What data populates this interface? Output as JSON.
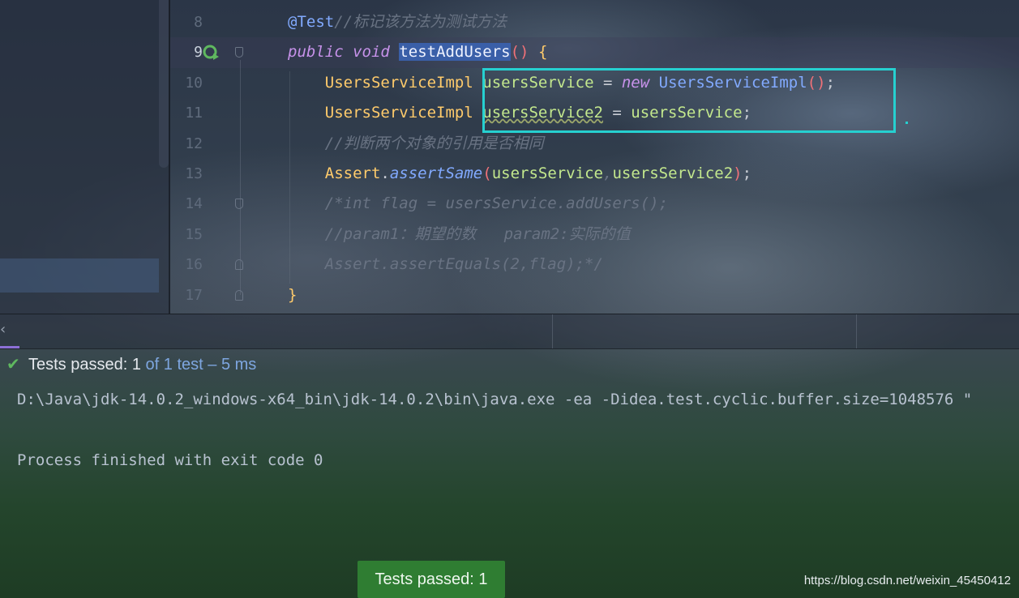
{
  "editor": {
    "current_line": "9",
    "lines": [
      {
        "num": "8",
        "tokens": [
          {
            "t": "@Test",
            "c": "ann"
          },
          {
            "t": "//标记该方法为测试方法",
            "c": "cmt"
          }
        ]
      },
      {
        "num": "9",
        "tokens": [
          {
            "t": "public",
            "c": "kw"
          },
          {
            "t": " "
          },
          {
            "t": "void",
            "c": "kw"
          },
          {
            "t": " "
          },
          {
            "t": "testAddUsers",
            "c": "hl"
          },
          {
            "t": "()",
            "c": "paren"
          },
          {
            "t": " "
          },
          {
            "t": "{",
            "c": "brace"
          }
        ]
      },
      {
        "num": "10",
        "tokens": [
          {
            "t": "    "
          },
          {
            "t": "UsersServiceImpl",
            "c": "ty"
          },
          {
            "t": " "
          },
          {
            "t": "usersService",
            "c": "var"
          },
          {
            "t": " = "
          },
          {
            "t": "new",
            "c": "kw"
          },
          {
            "t": " "
          },
          {
            "t": "UsersServiceImpl",
            "c": "fn"
          },
          {
            "t": "()",
            "c": "paren"
          },
          {
            "t": ";"
          }
        ]
      },
      {
        "num": "11",
        "tokens": [
          {
            "t": "    "
          },
          {
            "t": "UsersServiceImpl",
            "c": "ty"
          },
          {
            "t": " "
          },
          {
            "t": "usersService2",
            "c": "var squig"
          },
          {
            "t": " = "
          },
          {
            "t": "usersService",
            "c": "var"
          },
          {
            "t": ";"
          }
        ]
      },
      {
        "num": "12",
        "tokens": [
          {
            "t": "    "
          },
          {
            "t": "//判断两个对象的引用是否相同",
            "c": "cmt"
          }
        ]
      },
      {
        "num": "13",
        "tokens": [
          {
            "t": "    "
          },
          {
            "t": "Assert",
            "c": "ty"
          },
          {
            "t": "."
          },
          {
            "t": "assertSame",
            "c": "fni"
          },
          {
            "t": "(",
            "c": "paren"
          },
          {
            "t": "usersService",
            "c": "var"
          },
          {
            "t": ",",
            "c": "cmt"
          },
          {
            "t": "usersService2",
            "c": "var"
          },
          {
            "t": ")",
            "c": "paren"
          },
          {
            "t": ";"
          }
        ]
      },
      {
        "num": "14",
        "tokens": [
          {
            "t": "    "
          },
          {
            "t": "/*int flag = usersService.addUsers();",
            "c": "cmt"
          }
        ]
      },
      {
        "num": "15",
        "tokens": [
          {
            "t": "    "
          },
          {
            "t": "//param1：期望的数   param2:实际的值",
            "c": "cmt"
          }
        ]
      },
      {
        "num": "16",
        "tokens": [
          {
            "t": "    "
          },
          {
            "t": "Assert.assertEquals(2,flag);*/",
            "c": "cmt"
          }
        ]
      },
      {
        "num": "17",
        "tokens": [
          {
            "t": "}",
            "c": "brace"
          }
        ]
      }
    ]
  },
  "test_status": {
    "prefix": "Tests passed: ",
    "passed": "1",
    "of_label": " of ",
    "total": "1 test",
    "separator": " – ",
    "duration": "5 ms"
  },
  "console": {
    "command": "D:\\Java\\jdk-14.0.2_windows-x64_bin\\jdk-14.0.2\\bin\\java.exe -ea -Didea.test.cyclic.buffer.size=1048576 \"",
    "exit_message": "Process finished with exit code 0"
  },
  "toast": {
    "label": "Tests passed: 1"
  },
  "watermark": "https://blog.csdn.net/weixin_45450412",
  "colors": {
    "highlight_box": "#26d0d0",
    "pass_green": "#5fb85f",
    "toast_bg": "#2f7d32"
  }
}
